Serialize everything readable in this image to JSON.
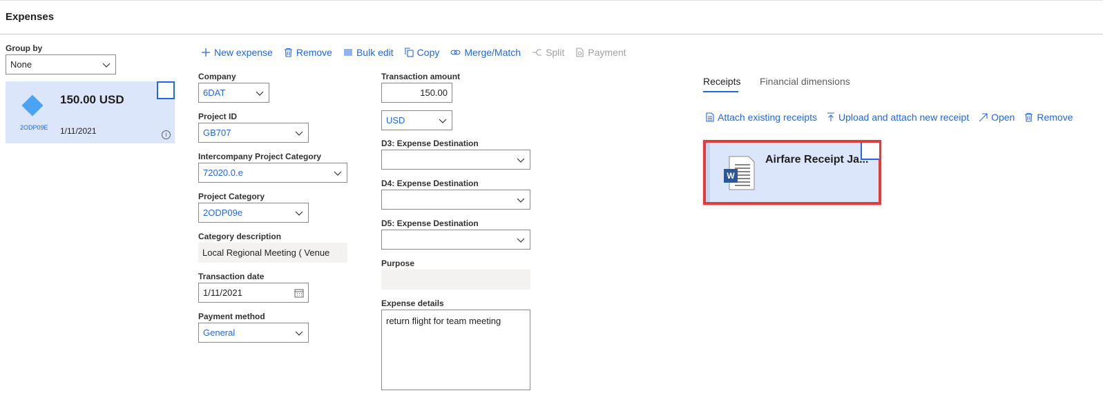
{
  "page": {
    "title": "Expenses"
  },
  "group_by": {
    "label": "Group by",
    "value": "None"
  },
  "expense_card": {
    "amount": "150.00 USD",
    "code": "2ODP09E",
    "date": "1/11/2021",
    "info_glyph": "i"
  },
  "toolbar": {
    "new_expense": "New expense",
    "remove": "Remove",
    "bulk_edit": "Bulk edit",
    "copy": "Copy",
    "merge_match": "Merge/Match",
    "split": "Split",
    "payment": "Payment"
  },
  "form": {
    "company": {
      "label": "Company",
      "value": "6DAT"
    },
    "project_id": {
      "label": "Project ID",
      "value": "GB707"
    },
    "intercompany_category": {
      "label": "Intercompany Project Category",
      "value": "72020.0.e"
    },
    "project_category": {
      "label": "Project Category",
      "value": "2ODP09e"
    },
    "category_description": {
      "label": "Category description",
      "value": "Local Regional Meeting ( Venue"
    },
    "transaction_date": {
      "label": "Transaction date",
      "value": "1/11/2021"
    },
    "payment_method": {
      "label": "Payment method",
      "value": "General"
    },
    "transaction_amount": {
      "label": "Transaction amount",
      "value": "150.00"
    },
    "currency": {
      "value": "USD"
    },
    "d3": {
      "label": "D3: Expense Destination",
      "value": ""
    },
    "d4": {
      "label": "D4: Expense Destination",
      "value": ""
    },
    "d5": {
      "label": "D5: Expense Destination",
      "value": ""
    },
    "purpose": {
      "label": "Purpose",
      "value": ""
    },
    "expense_details": {
      "label": "Expense details",
      "value": "return flight for team meeting"
    }
  },
  "receipts_panel": {
    "tabs": [
      "Receipts",
      "Financial dimensions"
    ],
    "toolbar": {
      "attach_existing": "Attach existing receipts",
      "upload_attach": "Upload and attach new receipt",
      "open": "Open",
      "remove": "Remove"
    },
    "receipt": {
      "title": "Airfare Receipt Ja...",
      "doc_letter": "W"
    }
  },
  "colors": {
    "accent": "#2266e3",
    "card_selected_bg": "#dce6fb",
    "highlight_border": "#e03c3c",
    "diamond": "#4aa3f5"
  }
}
